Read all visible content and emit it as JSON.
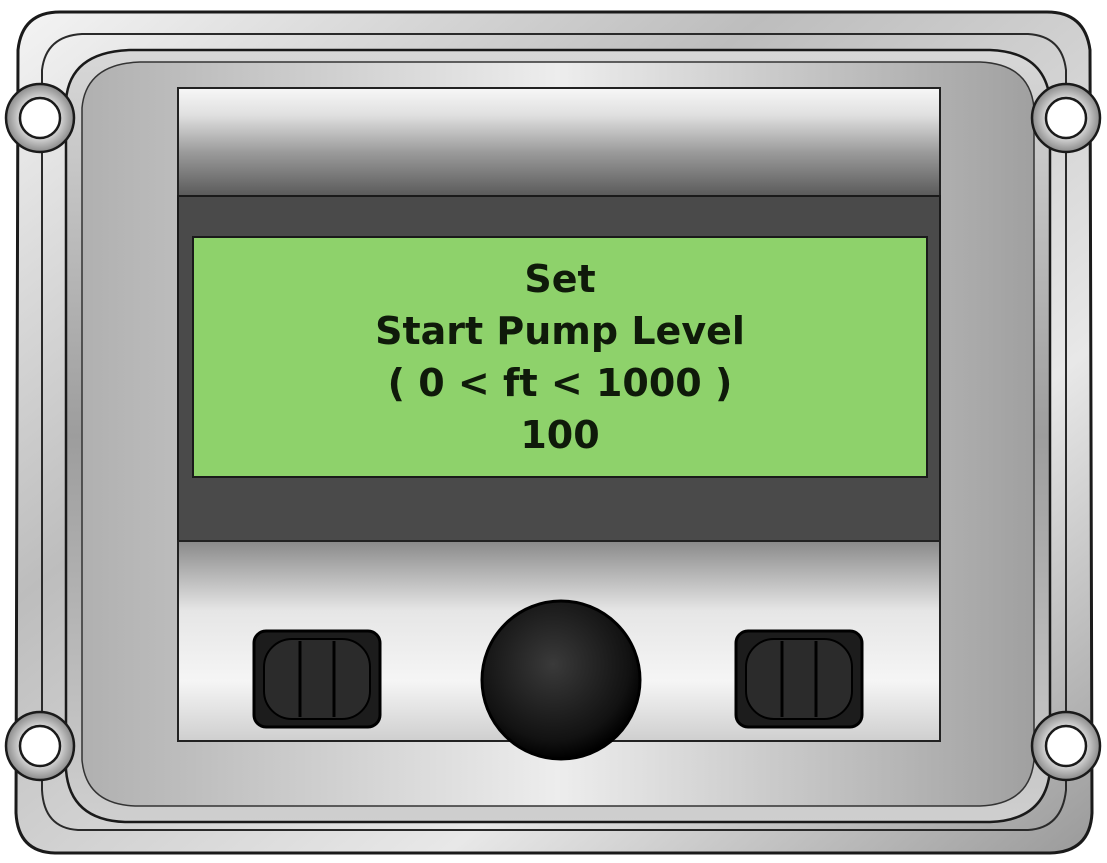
{
  "display": {
    "lines": [
      "Set",
      "Start Pump Level",
      "( 0 < ft < 1000 )",
      "100"
    ]
  },
  "controls": {
    "left_button": {
      "icon": "rocker-button-icon"
    },
    "center_button": {
      "icon": "round-knob-icon"
    },
    "right_button": {
      "icon": "rocker-button-icon"
    }
  },
  "colors": {
    "lcd_background": "#8ed26b",
    "lcd_text": "#0f1a0a",
    "housing": "#c9c9c9",
    "bezel_dark": "#4a4a4a"
  }
}
